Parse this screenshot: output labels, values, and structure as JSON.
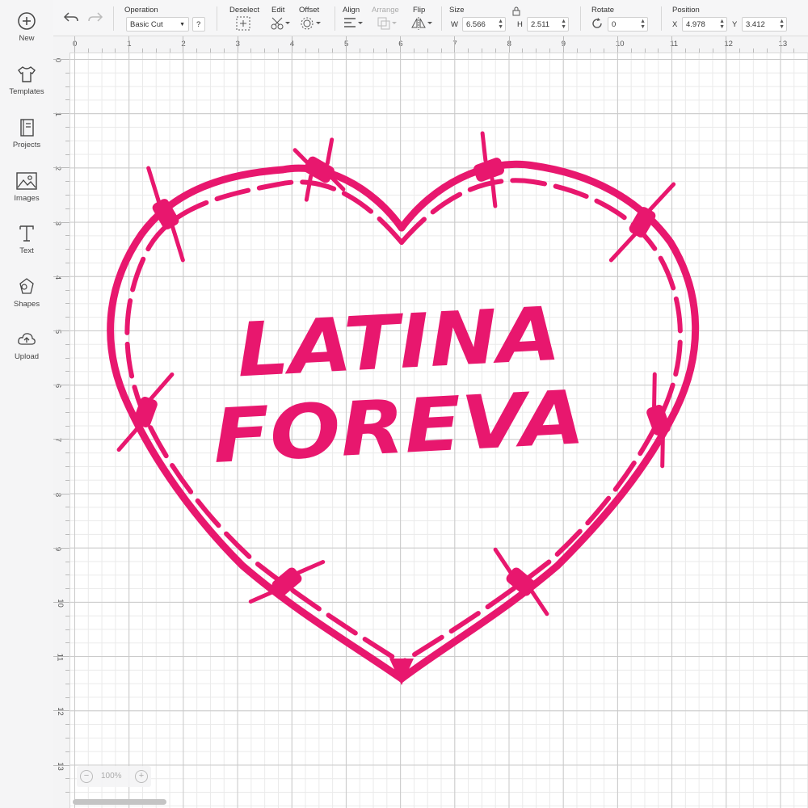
{
  "sidebar": {
    "items": [
      {
        "label": "New",
        "icon": "plus-circle-icon"
      },
      {
        "label": "Templates",
        "icon": "tshirt-icon"
      },
      {
        "label": "Projects",
        "icon": "notebook-icon"
      },
      {
        "label": "Images",
        "icon": "image-icon"
      },
      {
        "label": "Text",
        "icon": "text-icon"
      },
      {
        "label": "Shapes",
        "icon": "shapes-icon"
      },
      {
        "label": "Upload",
        "icon": "cloud-upload-icon"
      }
    ]
  },
  "toolbar": {
    "operation": {
      "label": "Operation",
      "value": "Basic Cut",
      "help": "?"
    },
    "deselect": {
      "label": "Deselect"
    },
    "edit": {
      "label": "Edit"
    },
    "offset": {
      "label": "Offset"
    },
    "align": {
      "label": "Align"
    },
    "arrange": {
      "label": "Arrange"
    },
    "flip": {
      "label": "Flip"
    },
    "size": {
      "label": "Size",
      "w_label": "W",
      "w": "6.566",
      "h_label": "H",
      "h": "2.511"
    },
    "rotate": {
      "label": "Rotate",
      "value": "0"
    },
    "position": {
      "label": "Position",
      "x_label": "X",
      "x": "4.978",
      "y_label": "Y",
      "y": "3.412"
    }
  },
  "rulers": {
    "top": [
      "0",
      "1",
      "2",
      "3",
      "4",
      "5",
      "6",
      "7",
      "8",
      "9",
      "10",
      "11",
      "12",
      "13"
    ],
    "left": [
      "0",
      "1",
      "2",
      "3",
      "4",
      "5",
      "6",
      "7",
      "8",
      "9",
      "10",
      "11",
      "12",
      "13"
    ]
  },
  "design": {
    "line1": "LATINA",
    "line2": "FOREVA",
    "color": "#e8176e"
  },
  "zoom": {
    "value": "100%",
    "minus": "−",
    "plus": "+"
  },
  "colors": {
    "accent": "#e8176e",
    "sidebar_bg": "#f5f5f6",
    "grid_major": "#c9c9c9",
    "grid_minor": "#eaeaea"
  }
}
